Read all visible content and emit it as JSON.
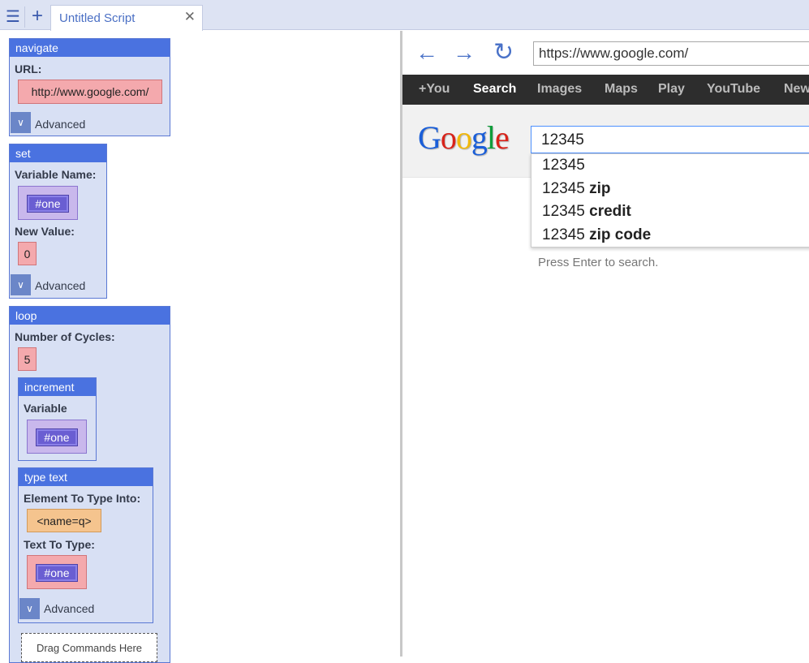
{
  "tabbar": {
    "menu_icon": "☰",
    "add_icon": "+",
    "tab_title": "Untitled Script",
    "close_icon": "✕"
  },
  "script": {
    "navigate": {
      "header": "navigate",
      "url_label": "URL:",
      "url_value": "http://www.google.com/",
      "advanced": "Advanced"
    },
    "set": {
      "header": "set",
      "var_label": "Variable Name:",
      "var_value": "#one",
      "new_value_label": "New Value:",
      "new_value": "0",
      "advanced": "Advanced"
    },
    "loop": {
      "header": "loop",
      "cycles_label": "Number of Cycles:",
      "cycles_value": "5",
      "increment": {
        "header": "increment",
        "var_label": "Variable",
        "var_value": "#one"
      },
      "type_text": {
        "header": "type text",
        "element_label": "Element To Type Into:",
        "element_value": "<name=q>",
        "text_label": "Text To Type:",
        "text_value": "#one",
        "advanced": "Advanced"
      }
    },
    "drag_hint": "Drag Commands Here"
  },
  "browser": {
    "back_icon": "←",
    "forward_icon": "→",
    "reload_icon": "↻",
    "url": "https://www.google.com/",
    "gbar": [
      "+You",
      "Search",
      "Images",
      "Maps",
      "Play",
      "YouTube",
      "News"
    ],
    "gbar_active": "Search",
    "logo_letters": [
      "G",
      "o",
      "o",
      "g",
      "l",
      "e"
    ],
    "logo_colors": [
      "#1a5ed8",
      "#d8231a",
      "#f1b80c",
      "#1a5ed8",
      "#0f9d3a",
      "#d8231a"
    ],
    "search_value": "12345",
    "suggestions": [
      {
        "base": "12345",
        "bold": ""
      },
      {
        "base": "12345 ",
        "bold": "zip"
      },
      {
        "base": "12345 ",
        "bold": "credit"
      },
      {
        "base": "12345 ",
        "bold": "zip code"
      }
    ],
    "hint": "Press Enter to search."
  }
}
